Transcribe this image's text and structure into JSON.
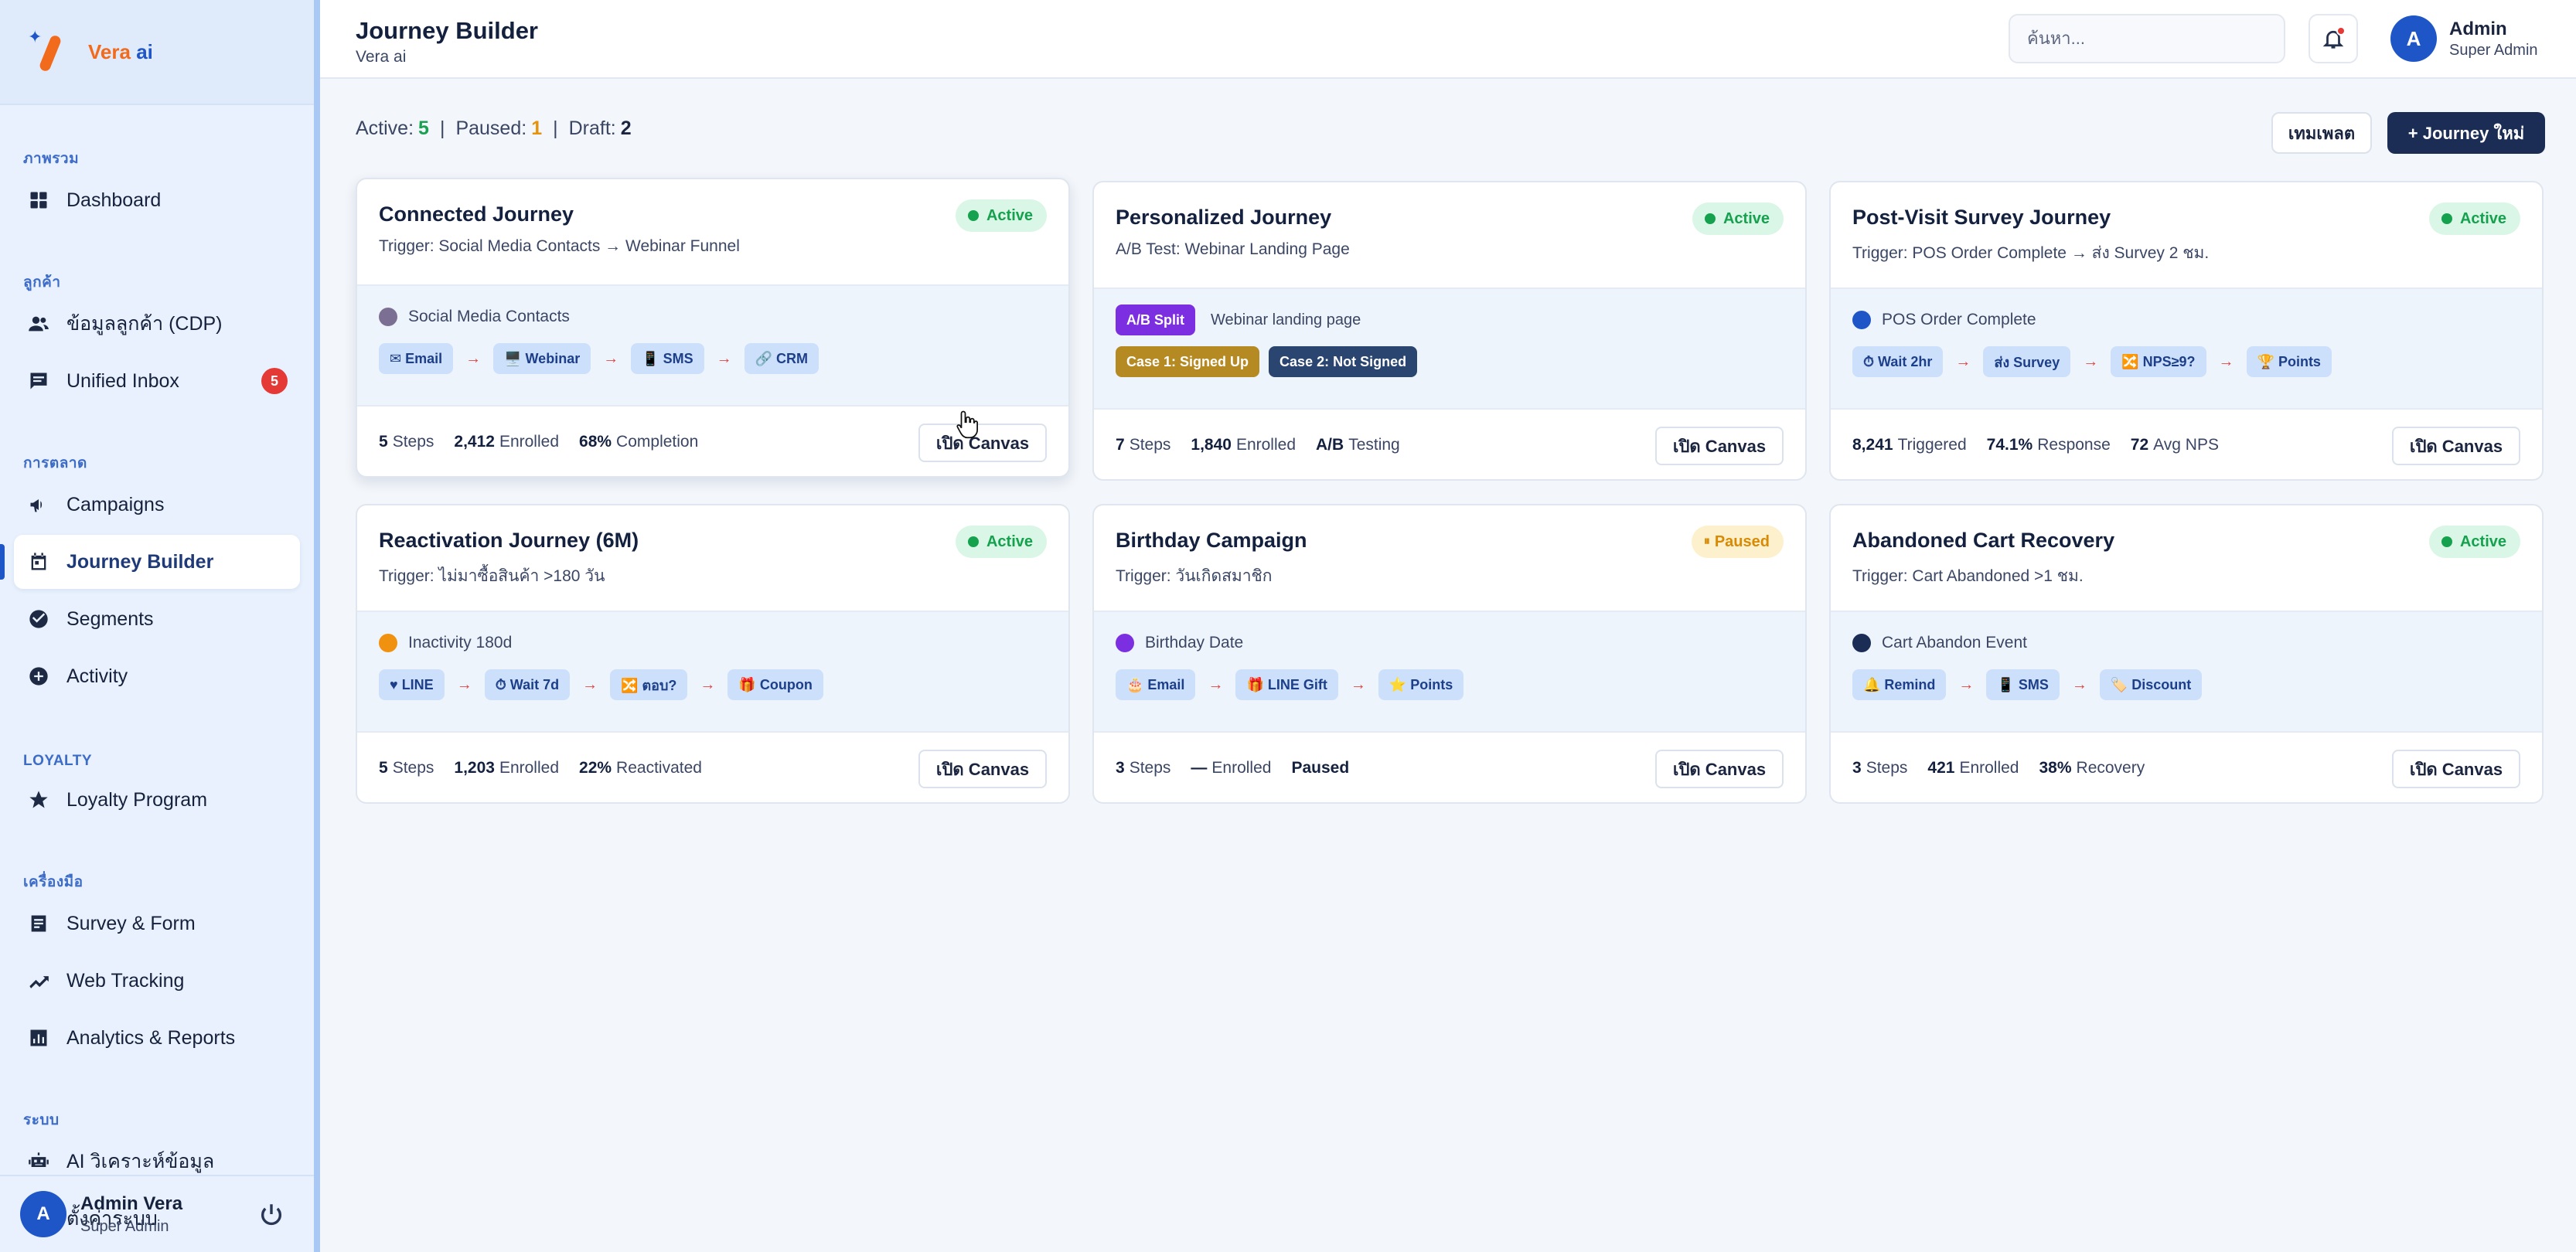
{
  "app": {
    "brand": {
      "name_main": "Vera",
      "name_ai": "ai"
    }
  },
  "sidebar": {
    "sections": [
      {
        "title": "ภาพรวม",
        "items": [
          {
            "label": "Dashboard",
            "icon": "grid-icon"
          }
        ]
      },
      {
        "title": "ลูกค้า",
        "items": [
          {
            "label": "ข้อมูลลูกค้า (CDP)",
            "icon": "users-icon"
          },
          {
            "label": "Unified Inbox",
            "icon": "chat-icon",
            "badge": "5"
          }
        ]
      },
      {
        "title": "การตลาด",
        "items": [
          {
            "label": "Campaigns",
            "icon": "megaphone-icon"
          },
          {
            "label": "Journey Builder",
            "icon": "calendar-icon",
            "active": true
          },
          {
            "label": "Segments",
            "icon": "check-circle-icon"
          },
          {
            "label": "Activity",
            "icon": "plus-circle-icon"
          }
        ]
      },
      {
        "title": "LOYALTY",
        "items": [
          {
            "label": "Loyalty Program",
            "icon": "star-icon"
          }
        ]
      },
      {
        "title": "เครื่องมือ",
        "items": [
          {
            "label": "Survey & Form",
            "icon": "form-icon"
          },
          {
            "label": "Web Tracking",
            "icon": "trend-icon"
          },
          {
            "label": "Analytics & Reports",
            "icon": "bar-chart-icon"
          }
        ]
      },
      {
        "title": "ระบบ",
        "items": [
          {
            "label": "AI วิเคราะห์ข้อมูล",
            "icon": "robot-icon"
          },
          {
            "label": "ตั้งค่าระบบ",
            "icon": "gear-icon"
          }
        ]
      }
    ],
    "footer": {
      "avatar": "A",
      "name": "Admin Vera",
      "role": "Super Admin"
    }
  },
  "header": {
    "title": "Journey Builder",
    "subtitle": "Vera ai",
    "search_placeholder": "ค้นหา...",
    "user": {
      "avatar": "A",
      "name": "Admin",
      "role": "Super Admin"
    }
  },
  "stats": {
    "active_label": "Active:",
    "active": "5",
    "paused_label": "Paused:",
    "paused": "1",
    "draft_label": "Draft:",
    "draft": "2",
    "separator": "|"
  },
  "actions": {
    "template": "เทมเพลต",
    "new_journey": "+ Journey ใหม่"
  },
  "canvas_button": "เปิด Canvas",
  "flow_arrow": "→",
  "cards": [
    {
      "title": "Connected Journey",
      "status": "Active",
      "trigger": "Trigger: Social Media Contacts → Webinar Funnel",
      "source": "Social Media Contacts",
      "source_color": "#7b6f93",
      "steps": [
        "✉ Email",
        "🖥️ Webinar",
        "📱 SMS",
        "🔗 CRM"
      ],
      "metrics": [
        {
          "v": "5",
          "l": "Steps"
        },
        {
          "v": "2,412",
          "l": "Enrolled"
        },
        {
          "v": "68%",
          "l": "Completion"
        }
      ]
    },
    {
      "title": "Personalized Journey",
      "status": "Active",
      "trigger": "A/B Test: Webinar Landing Page",
      "ab_tag": "A/B Split",
      "ab_desc": "Webinar landing page",
      "cases": [
        "Case 1: Signed Up",
        "Case 2: Not Signed"
      ],
      "metrics": [
        {
          "v": "7",
          "l": "Steps"
        },
        {
          "v": "1,840",
          "l": "Enrolled"
        },
        {
          "v": "A/B",
          "l": "Testing"
        }
      ]
    },
    {
      "title": "Post-Visit Survey Journey",
      "status": "Active",
      "trigger": "Trigger: POS Order Complete → ส่ง Survey 2 ชม.",
      "source": "POS Order Complete",
      "source_color": "#1e56c8",
      "steps": [
        "⏱ Wait 2hr",
        "ส่ง Survey",
        "🔀 NPS≥9?",
        "🏆 Points"
      ],
      "metrics": [
        {
          "v": "8,241",
          "l": "Triggered"
        },
        {
          "v": "74.1%",
          "l": "Response"
        },
        {
          "v": "72",
          "l": "Avg NPS"
        }
      ]
    },
    {
      "title": "Reactivation Journey (6M)",
      "status": "Active",
      "trigger": "Trigger: ไม่มาซื้อสินค้า >180 วัน",
      "source": "Inactivity 180d",
      "source_color": "#f0920f",
      "steps": [
        "♥ LINE",
        "⏱ Wait 7d",
        "🔀 ตอบ?",
        "🎁 Coupon"
      ],
      "metrics": [
        {
          "v": "5",
          "l": "Steps"
        },
        {
          "v": "1,203",
          "l": "Enrolled"
        },
        {
          "v": "22%",
          "l": "Reactivated"
        }
      ]
    },
    {
      "title": "Birthday Campaign",
      "status": "Paused",
      "trigger": "Trigger: วันเกิดสมาชิก",
      "source": "Birthday Date",
      "source_color": "#7b2fe0",
      "steps": [
        "🎂 Email",
        "🎁 LINE Gift",
        "⭐ Points"
      ],
      "metrics": [
        {
          "v": "3",
          "l": "Steps"
        },
        {
          "v": "—",
          "l": "Enrolled"
        },
        {
          "v": "Paused",
          "l": ""
        }
      ]
    },
    {
      "title": "Abandoned Cart Recovery",
      "status": "Active",
      "trigger": "Trigger: Cart Abandoned >1 ชม.",
      "source": "Cart Abandon Event",
      "source_color": "#1b2c55",
      "steps": [
        "🔔 Remind",
        "📱 SMS",
        "🏷️ Discount"
      ],
      "metrics": [
        {
          "v": "3",
          "l": "Steps"
        },
        {
          "v": "421",
          "l": "Enrolled"
        },
        {
          "v": "38%",
          "l": "Recovery"
        }
      ]
    }
  ]
}
